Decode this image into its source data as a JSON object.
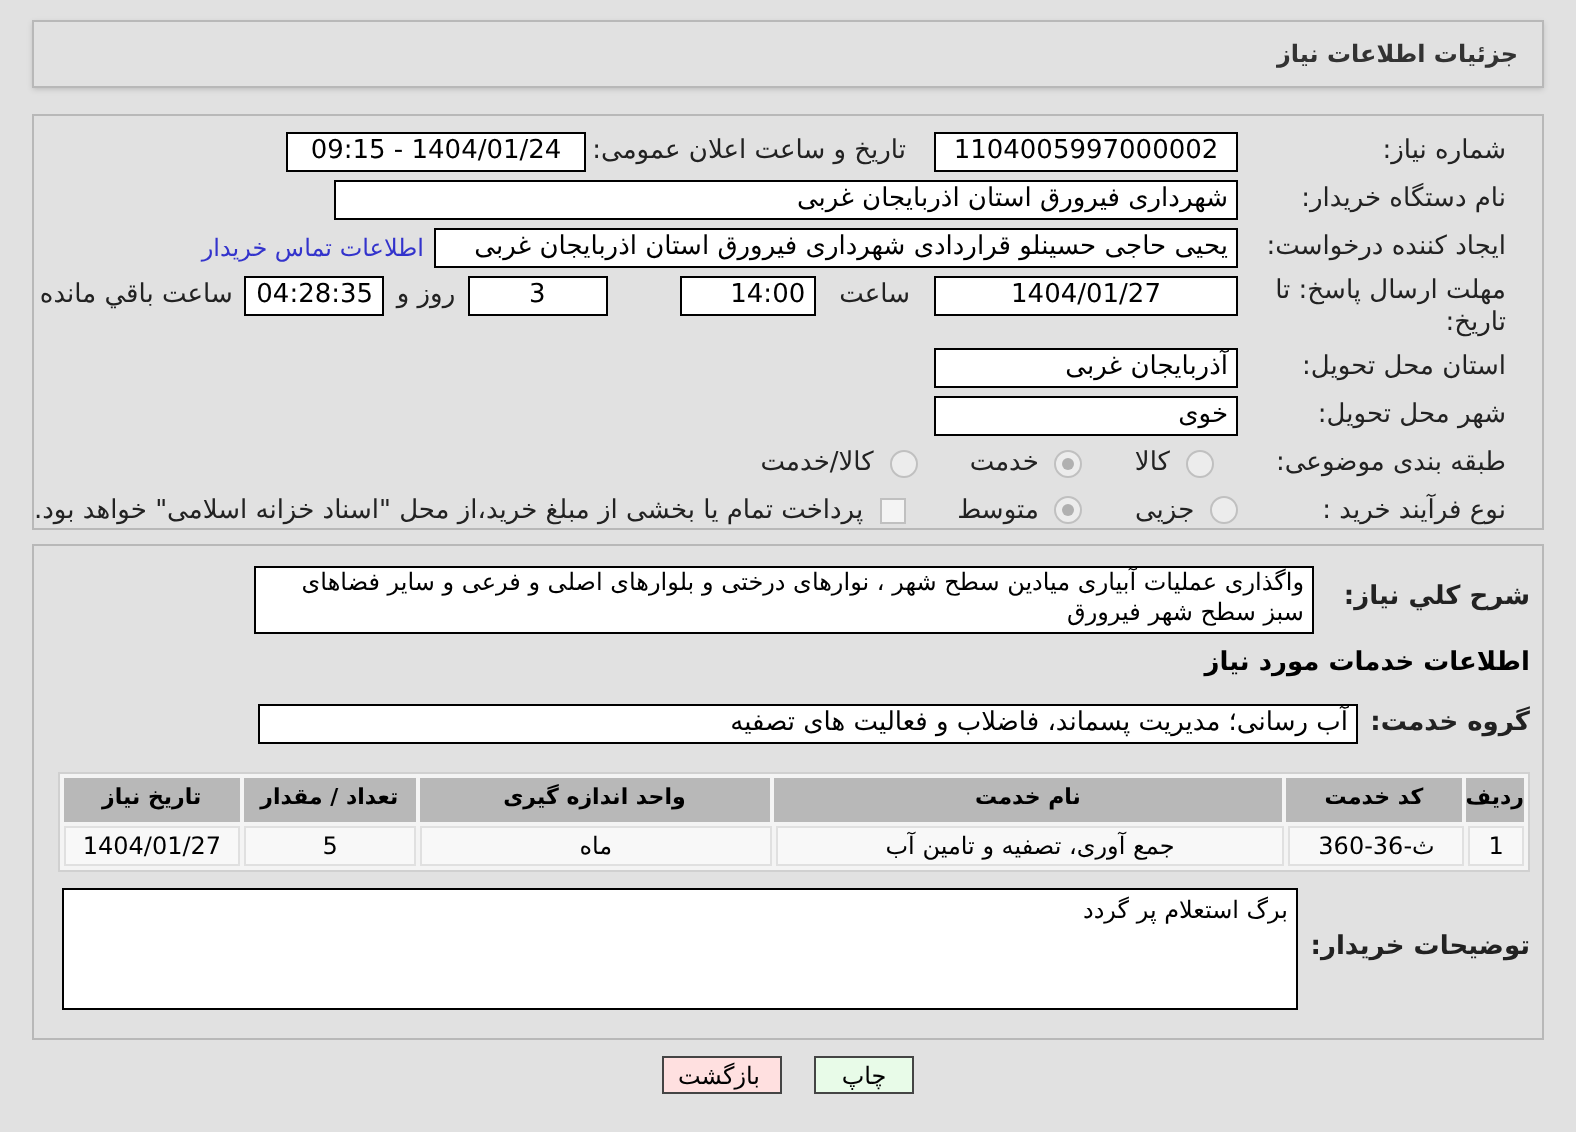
{
  "header": {
    "title": "جزئیات اطلاعات نیاز"
  },
  "form": {
    "need_number": {
      "label": "شماره نیاز:",
      "value": "1104005997000002"
    },
    "announce": {
      "label": "تاریخ و ساعت اعلان عمومی:",
      "value": "1404/01/24 - 09:15"
    },
    "buyer": {
      "label": "نام دستگاه خریدار:",
      "value": "شهرداری فیرورق استان اذربایجان غربی"
    },
    "requester": {
      "label": "ایجاد کننده درخواست:",
      "value": "یحیی حاجی حسینلو قراردادی شهرداری فیرورق استان اذربایجان غربی"
    },
    "contact_link": "اطلاعات تماس خریدار",
    "deadline": {
      "label": "مهلت ارسال پاسخ: تا تاریخ:",
      "date": "1404/01/27",
      "time_label": "ساعت",
      "time": "14:00",
      "days": "3",
      "days_label": "روز و",
      "remaining": "04:28:35",
      "remaining_label": "ساعت باقي مانده"
    },
    "province": {
      "label": "استان محل تحویل:",
      "value": "آذربایجان غربی"
    },
    "city": {
      "label": "شهر محل تحویل:",
      "value": "خوی"
    },
    "category": {
      "label": "طبقه بندی موضوعی:",
      "options": [
        {
          "label": "کالا",
          "selected": false
        },
        {
          "label": "خدمت",
          "selected": true
        },
        {
          "label": "کالا/خدمت",
          "selected": false
        }
      ]
    },
    "process": {
      "label": "نوع فرآیند خرید :",
      "options": [
        {
          "label": "جزیی",
          "selected": false
        },
        {
          "label": "متوسط",
          "selected": true
        }
      ],
      "payment": {
        "label": "پرداخت تمام یا بخشی از مبلغ خرید،از محل \"اسناد خزانه اسلامی\" خواهد بود.",
        "checked": false
      }
    }
  },
  "details": {
    "description": {
      "label": "شرح کلي نياز:",
      "value": "واگذاری عملیات آبیاری میادین سطح شهر ، نوارهای درختی و بلوارهای اصلی و فرعی و سایر فضاهای سبز سطح شهر فیرورق"
    },
    "services_title": "اطلاعات خدمات مورد نیاز",
    "service_group": {
      "label": "گروه خدمت:",
      "value": "آب رسانی؛ مدیریت پسماند، فاضلاب و فعالیت های تصفیه"
    },
    "table": {
      "columns": [
        "ردیف",
        "کد خدمت",
        "نام خدمت",
        "واحد اندازه گیری",
        "تعداد / مقدار",
        "تاریخ نیاز"
      ],
      "rows": [
        [
          "1",
          "ث-36-360",
          "جمع آوری، تصفیه و تامین آب",
          "ماه",
          "5",
          "1404/01/27"
        ]
      ]
    },
    "buyer_notes": {
      "label": "توضیحات خریدار:",
      "value": "برگ استعلام پر گردد"
    }
  },
  "buttons": [
    {
      "label": "چاپ",
      "kind": "print"
    },
    {
      "label": "بازگشت",
      "kind": "back"
    }
  ]
}
